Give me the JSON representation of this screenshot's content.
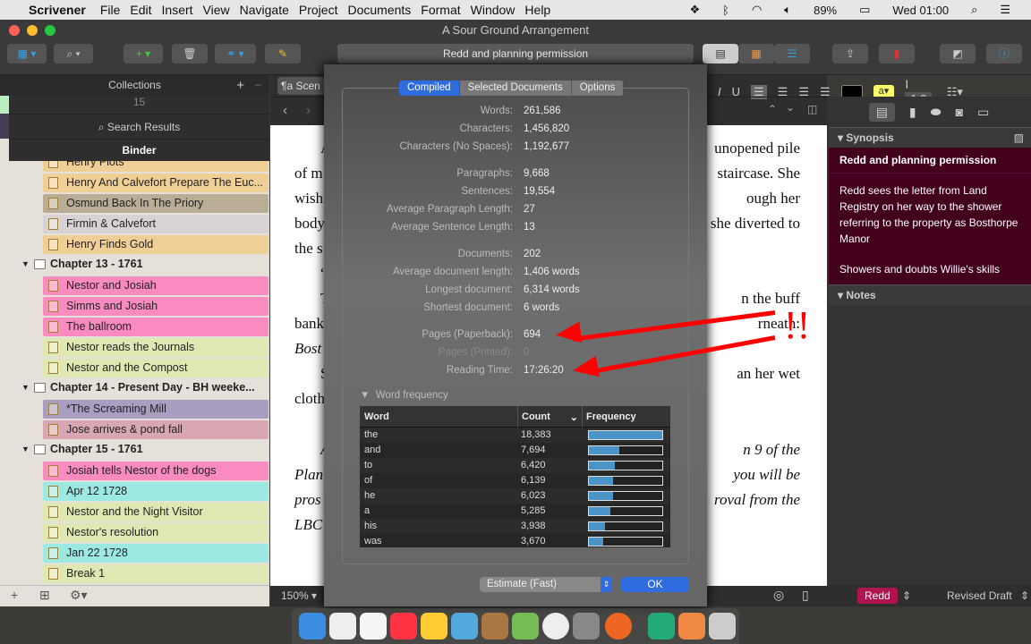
{
  "menubar": {
    "app": "Scrivener",
    "items": [
      "File",
      "Edit",
      "Insert",
      "View",
      "Navigate",
      "Project",
      "Documents",
      "Format",
      "Window",
      "Help"
    ],
    "battery": "89%",
    "clock": "Wed 01:00"
  },
  "window": {
    "title": "A Sour Ground Arrangement",
    "document_field": "Redd and planning permission"
  },
  "binder": {
    "collections_label": "Collections",
    "count_partial": "15",
    "search_results": "Search Results",
    "binder_label": "Binder",
    "items": [
      {
        "type": "doc",
        "label": "Henry Plots",
        "color": "#f0cf96"
      },
      {
        "type": "doc",
        "label": "Henry And Calvefort Prepare The Euc...",
        "color": "#f0cf96"
      },
      {
        "type": "doc",
        "label": "Osmund Back In The Priory",
        "color": "#b9ad96"
      },
      {
        "type": "doc",
        "label": "Firmin & Calvefort",
        "color": "#d7d3d4"
      },
      {
        "type": "doc",
        "label": "Henry Finds Gold",
        "color": "#f0cf96"
      },
      {
        "type": "folder",
        "label": "Chapter 13 - 1761"
      },
      {
        "type": "doc",
        "label": "Nestor and Josiah",
        "color": "#f98bc0"
      },
      {
        "type": "doc",
        "label": "Simms and Josiah",
        "color": "#f98bc0"
      },
      {
        "type": "doc",
        "label": "The ballroom",
        "color": "#f98bc0"
      },
      {
        "type": "doc",
        "label": "Nestor reads the Journals",
        "color": "#dfe8b3"
      },
      {
        "type": "doc",
        "label": "Nestor and the Compost",
        "color": "#dfe8b3"
      },
      {
        "type": "folder",
        "label": "Chapter 14 - Present Day - BH weeke..."
      },
      {
        "type": "doc",
        "label": "*The Screaming Mill",
        "color": "#aa9dc2"
      },
      {
        "type": "doc",
        "label": "Jose arrives & pond fall",
        "color": "#d9a7b4"
      },
      {
        "type": "folder",
        "label": "Chapter 15 - 1761"
      },
      {
        "type": "doc",
        "label": "Josiah tells Nestor of the dogs",
        "color": "#f98bc0"
      },
      {
        "type": "doc",
        "label": "Apr 12 1728",
        "color": "#9ce8e2"
      },
      {
        "type": "doc",
        "label": "Nestor and the Night Visitor",
        "color": "#dfe8b3"
      },
      {
        "type": "doc",
        "label": "Nestor's resolution",
        "color": "#dfe8b3"
      },
      {
        "type": "doc",
        "label": "Jan 22 1728",
        "color": "#9ce8e2"
      },
      {
        "type": "doc",
        "label": "Break 1",
        "color": "#dfe8b3"
      }
    ]
  },
  "editor": {
    "header_partial": "Scen",
    "zoom": "150%",
    "line_spacing": "1.3",
    "left_fragments": [
      [
        "A",
        false
      ],
      [
        "of m",
        false
      ],
      [
        "wish",
        false
      ],
      [
        "body",
        false
      ],
      [
        "the s",
        false
      ],
      [
        "“",
        false
      ],
      [
        "T",
        false
      ],
      [
        "bank",
        false
      ],
      [
        "Bost",
        true
      ],
      [
        "S",
        false
      ],
      [
        "cloth",
        false
      ],
      [
        "A",
        true
      ],
      [
        "Plan",
        true
      ],
      [
        "pros",
        true
      ],
      [
        "LBC",
        true
      ]
    ],
    "right_fragments": [
      [
        "unopened pile",
        false,
        0
      ],
      [
        "staircase. She",
        false,
        1
      ],
      [
        "ough her",
        false,
        2
      ],
      [
        "she diverted to",
        false,
        3
      ],
      [
        "n the buff",
        false,
        6
      ],
      [
        "rneath:",
        false,
        7
      ],
      [
        "an her wet",
        false,
        9
      ],
      [
        "n 9 of the",
        true,
        11
      ],
      [
        "you will be",
        true,
        12
      ],
      [
        "roval from the",
        true,
        13
      ]
    ]
  },
  "inspector": {
    "synopsis_label": "Synopsis",
    "title": "Redd and planning permission",
    "synopsis": "Redd sees the letter from Land Registry on her way to the shower referring to the property as Bosthorpe Manor",
    "synopsis2": "Showers and doubts Willie's skills",
    "notes_label": "Notes",
    "label_value": "Redd",
    "status_value": "Revised Draft",
    "label_color": "#b0144e"
  },
  "stats": {
    "tabs": [
      "Compiled",
      "Selected Documents",
      "Options"
    ],
    "active_tab": "Compiled",
    "rows": [
      {
        "label": "Words:",
        "value": "261,586"
      },
      {
        "label": "Characters:",
        "value": "1,456,820"
      },
      {
        "label": "Characters (No Spaces):",
        "value": "1,192,677"
      },
      {
        "label": "Paragraphs:",
        "value": "9,668"
      },
      {
        "label": "Sentences:",
        "value": "19,554"
      },
      {
        "label": "Average Paragraph Length:",
        "value": "27"
      },
      {
        "label": "Average Sentence Length:",
        "value": "13"
      },
      {
        "label": "Documents:",
        "value": "202"
      },
      {
        "label": "Average document length:",
        "value": "1,406 words"
      },
      {
        "label": "Longest document:",
        "value": "6,314 words"
      },
      {
        "label": "Shortest document:",
        "value": "6 words"
      },
      {
        "label": "Pages (Paperback):",
        "value": "694"
      },
      {
        "label": "Pages (Printed):",
        "value": "0",
        "dim": true
      },
      {
        "label": "Reading Time:",
        "value": "17:26:20"
      }
    ],
    "word_frequency_label": "Word frequency",
    "columns": [
      "Word",
      "Count",
      "Frequency"
    ],
    "words": [
      [
        "the",
        "18,383",
        1.0
      ],
      [
        "and",
        "7,694",
        0.4185
      ],
      [
        "to",
        "6,420",
        0.3492
      ],
      [
        "of",
        "6,139",
        0.3339
      ],
      [
        "he",
        "6,023",
        0.3276
      ],
      [
        "a",
        "5,285",
        0.2875
      ],
      [
        "his",
        "3,938",
        0.2142
      ],
      [
        "was",
        "3,670",
        0.1996
      ]
    ],
    "estimate_select": "Estimate (Fast)",
    "ok": "OK"
  },
  "annotation": {
    "text": "!!",
    "color": "#ff0000"
  }
}
